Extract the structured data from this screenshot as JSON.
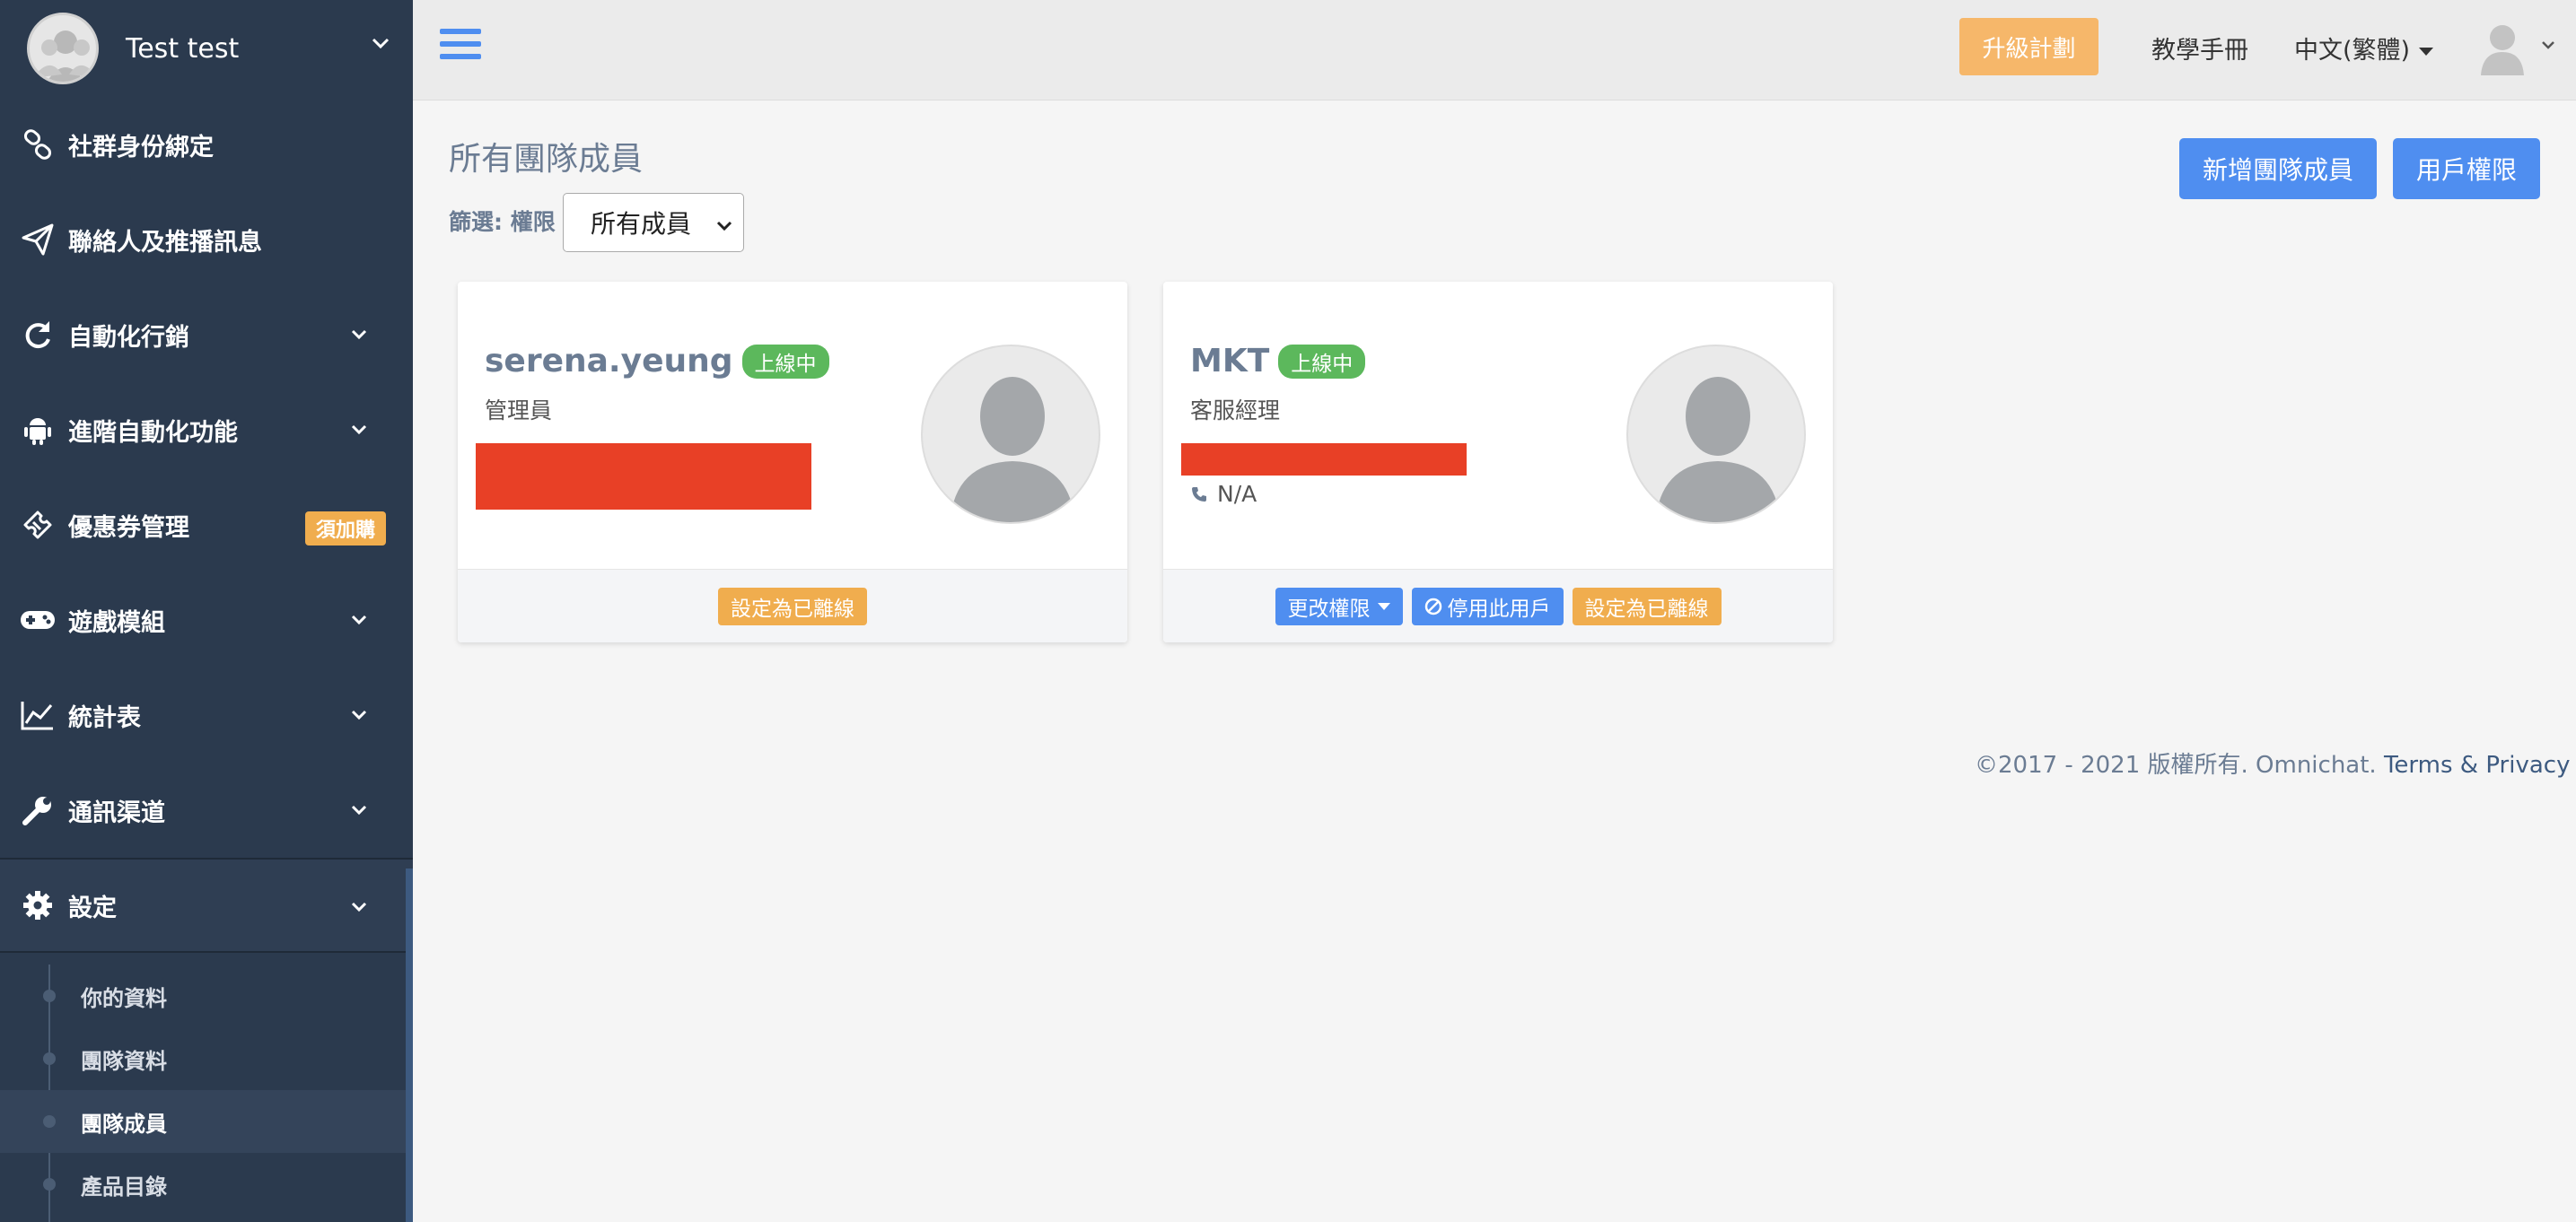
{
  "sidebar": {
    "profile_name": "Test test",
    "items": [
      {
        "label": "社群身份綁定",
        "icon": "link-icon"
      },
      {
        "label": "聯絡人及推播訊息",
        "icon": "paper-plane-icon"
      },
      {
        "label": "自動化行銷",
        "icon": "refresh-icon"
      },
      {
        "label": "進階自動化功能",
        "icon": "android-icon"
      },
      {
        "label": "優惠券管理",
        "icon": "ticket-icon",
        "badge": "須加購"
      },
      {
        "label": "遊戲模組",
        "icon": "gamepad-icon"
      },
      {
        "label": "統計表",
        "icon": "line-chart-icon"
      },
      {
        "label": "通訊渠道",
        "icon": "wrench-icon"
      },
      {
        "label": "設定",
        "icon": "gear-icon"
      }
    ],
    "subitems": [
      "你的資料",
      "團隊資料",
      "團隊成員",
      "產品目錄"
    ]
  },
  "topbar": {
    "upgrade": "升級計劃",
    "manual": "教學手冊",
    "language": "中文(繁體)"
  },
  "main": {
    "title": "所有團隊成員",
    "filter_label": "篩選: 權限",
    "filter_value": "所有成員",
    "add_member": "新增團隊成員",
    "user_permissions": "用戶權限"
  },
  "members": [
    {
      "name": "serena.yeung",
      "status": "上線中",
      "role": "管理員",
      "set_offline": "設定為已離線"
    },
    {
      "name": "MKT",
      "status": "上線中",
      "role": "客服經理",
      "phone": "N/A",
      "change_perm": "更改權限",
      "disable": "停用此用戶",
      "set_offline": "設定為已離線"
    }
  ],
  "footer": {
    "copyright": "©2017 - 2021 版權所有. Omnichat.",
    "link": "Terms & Privacy"
  },
  "colors": {
    "sidebar": "#2b3a4e",
    "primary": "#4f8ef0",
    "warning": "#f0ad4e",
    "success": "#5cb85c",
    "redaction": "#e84026"
  }
}
